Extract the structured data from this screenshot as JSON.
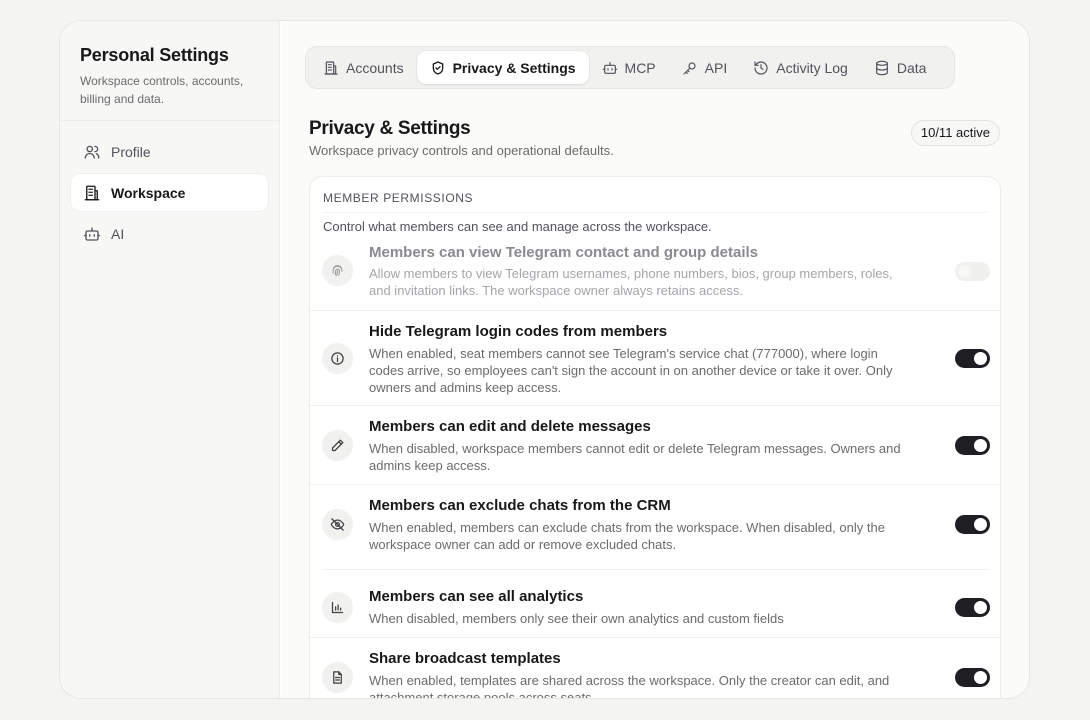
{
  "sidebar": {
    "title": "Personal Settings",
    "subtitle": "Workspace controls, accounts, billing and data.",
    "items": [
      {
        "label": "Profile",
        "icon": "users-icon"
      },
      {
        "label": "Workspace",
        "icon": "building-icon",
        "active": true
      },
      {
        "label": "AI",
        "icon": "bot-icon"
      }
    ]
  },
  "tabs": [
    {
      "label": "Accounts",
      "icon": "building-icon"
    },
    {
      "label": "Privacy & Settings",
      "icon": "shield-check-icon",
      "active": true
    },
    {
      "label": "MCP",
      "icon": "bot-icon"
    },
    {
      "label": "API",
      "icon": "key-icon"
    },
    {
      "label": "Activity Log",
      "icon": "history-icon"
    },
    {
      "label": "Data",
      "icon": "database-icon"
    }
  ],
  "page": {
    "title": "Privacy & Settings",
    "subtitle": "Workspace privacy controls and operational defaults.",
    "badge": "10/11 active"
  },
  "section": {
    "title": "MEMBER PERMISSIONS",
    "subtitle": "Control what members can see and manage across the workspace."
  },
  "settings": [
    {
      "title": "Members can view Telegram contact and group details",
      "description": "Allow members to view Telegram usernames, phone numbers, bios, group members, roles, and invitation links. The workspace owner always retains access.",
      "icon": "fingerprint-icon",
      "enabled": false,
      "disabled": true
    },
    {
      "title": "Hide Telegram login codes from members",
      "description": "When enabled, seat members cannot see Telegram's service chat (777000), where login codes arrive, so employees can't sign the account in on another device or take it over. Only owners and admins keep access.",
      "icon": "info-icon",
      "enabled": true
    },
    {
      "title": "Members can edit and delete messages",
      "description": "When disabled, workspace members cannot edit or delete Telegram messages. Owners and admins keep access.",
      "icon": "pencil-icon",
      "enabled": true
    },
    {
      "title": "Members can exclude chats from the CRM",
      "description": "When enabled, members can exclude chats from the workspace. When disabled, only the workspace owner can add or remove excluded chats.",
      "icon": "eye-off-icon",
      "enabled": true
    },
    {
      "title": "Members can see all analytics",
      "description": "When disabled, members only see their own analytics and custom fields",
      "icon": "bar-chart-icon",
      "enabled": true
    },
    {
      "title": "Share broadcast templates",
      "description": "When enabled, templates are shared across the workspace. Only the creator can edit, and attachment storage pools across seats.",
      "icon": "file-text-icon",
      "enabled": true
    }
  ],
  "colors": {
    "background": "#f4f4f3",
    "toggle_on": "#1f1f23",
    "text_primary": "#18181b",
    "text_muted": "#6b6b6b"
  }
}
